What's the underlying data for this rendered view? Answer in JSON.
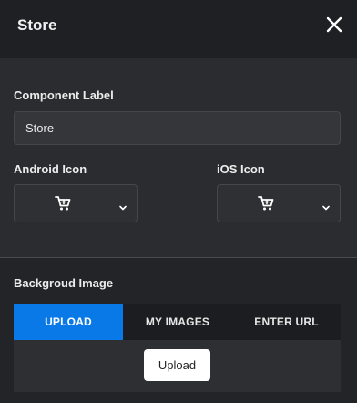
{
  "header": {
    "title": "Store",
    "close_icon": "close-icon"
  },
  "component_label": {
    "label": "Component Label",
    "value": "Store"
  },
  "android_icon": {
    "label": "Android Icon",
    "icon": "shopping-cart-icon"
  },
  "ios_icon": {
    "label": "iOS Icon",
    "icon": "shopping-cart-icon"
  },
  "background_image": {
    "label": "Backgroud Image",
    "tabs": [
      {
        "label": "UPLOAD",
        "active": true
      },
      {
        "label": "MY IMAGES",
        "active": false
      },
      {
        "label": "ENTER URL",
        "active": false
      }
    ],
    "upload_button": "Upload"
  },
  "colors": {
    "accent": "#0a79e8",
    "header_bg": "#1f2023",
    "panel_bg": "#2b2c2f"
  }
}
